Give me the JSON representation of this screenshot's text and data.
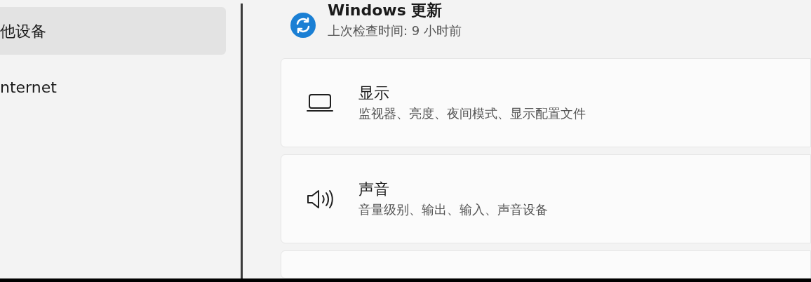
{
  "sidebar": {
    "items": [
      {
        "label": "他设备",
        "selected": true
      },
      {
        "label": "nternet",
        "selected": false
      }
    ]
  },
  "update": {
    "title": "Windows 更新",
    "subtitle": "上次检查时间: 9 小时前"
  },
  "cards": [
    {
      "kind": "display",
      "title": "显示",
      "subtitle": "监视器、亮度、夜间模式、显示配置文件"
    },
    {
      "kind": "sound",
      "title": "声音",
      "subtitle": "音量级别、输出、输入、声音设备"
    }
  ]
}
